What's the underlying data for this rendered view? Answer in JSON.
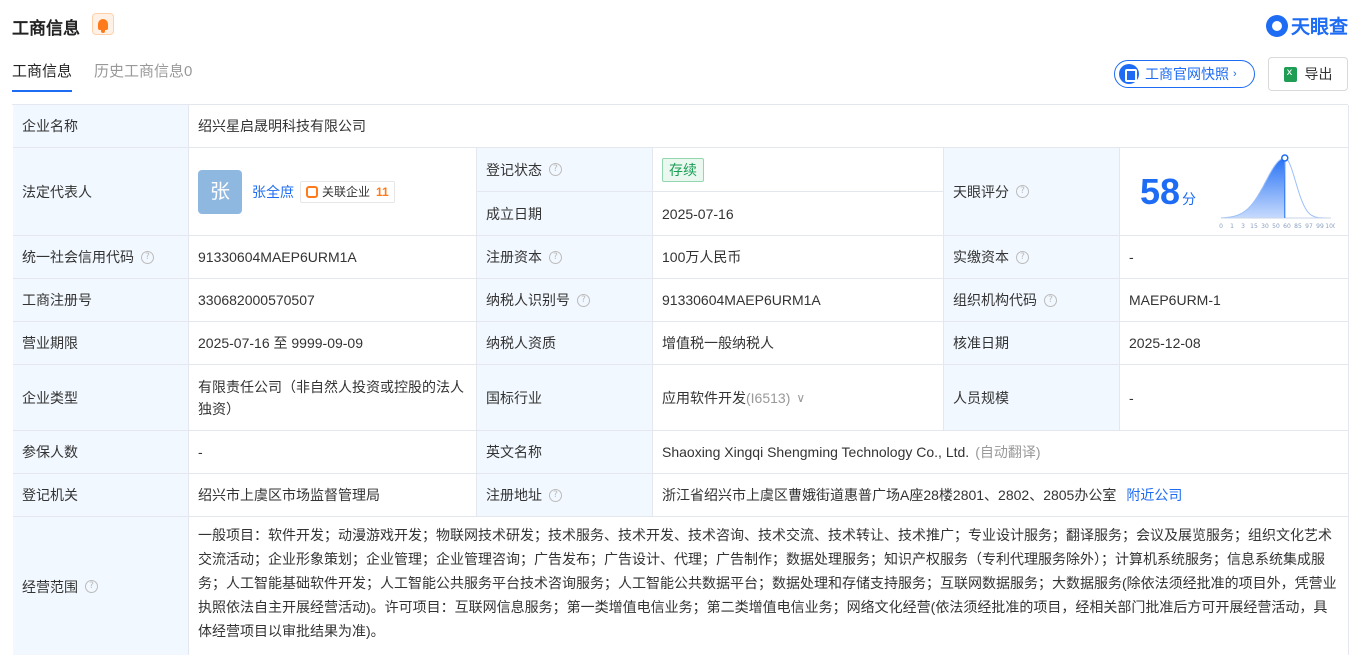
{
  "header": {
    "title": "工商信息",
    "logo_text": "天眼查"
  },
  "tabs": [
    {
      "label": "工商信息",
      "active": true
    },
    {
      "label": "历史工商信息0",
      "active": false
    }
  ],
  "actions": {
    "snapshot_label": "工商官网快照",
    "export_label": "导出"
  },
  "company": {
    "name_label": "企业名称",
    "name": "绍兴星启晟明科技有限公司",
    "legal_rep_label": "法定代表人",
    "legal_rep_avatar": "张",
    "legal_rep": "张全庶",
    "related_label": "关联企业",
    "related_count": "11",
    "status_label": "登记状态",
    "status": "存续",
    "founded_label": "成立日期",
    "founded": "2025-07-16",
    "score_label": "天眼评分",
    "score": "58",
    "score_unit": "分",
    "credit_code_label": "统一社会信用代码",
    "credit_code": "91330604MAEP6URM1A",
    "capital_label": "注册资本",
    "capital": "100万人民币",
    "paid_capital_label": "实缴资本",
    "paid_capital": "-",
    "reg_no_label": "工商注册号",
    "reg_no": "330682000570507",
    "taxpayer_id_label": "纳税人识别号",
    "taxpayer_id": "91330604MAEP6URM1A",
    "org_code_label": "组织机构代码",
    "org_code": "MAEP6URM-1",
    "term_label": "营业期限",
    "term": "2025-07-16 至 9999-09-09",
    "taxpayer_type_label": "纳税人资质",
    "taxpayer_type": "增值税一般纳税人",
    "approved_label": "核准日期",
    "approved": "2025-12-08",
    "type_label": "企业类型",
    "type": "有限责任公司（非自然人投资或控股的法人独资）",
    "industry_label": "国标行业",
    "industry": "应用软件开发",
    "industry_code": "(I6513)",
    "staff_label": "人员规模",
    "staff": "-",
    "insured_label": "参保人数",
    "insured": "-",
    "en_name_label": "英文名称",
    "en_name": "Shaoxing Xingqi Shengming Technology Co., Ltd.",
    "en_name_note": "(自动翻译)",
    "authority_label": "登记机关",
    "authority": "绍兴市上虞区市场监督管理局",
    "address_label": "注册地址",
    "address": "浙江省绍兴市上虞区曹娥街道惠普广场A座28楼2801、2802、2805办公室",
    "nearby_link": "附近公司",
    "scope_label": "经营范围",
    "scope": "一般项目：软件开发；动漫游戏开发；物联网技术研发；技术服务、技术开发、技术咨询、技术交流、技术转让、技术推广；专业设计服务；翻译服务；会议及展览服务；组织文化艺术交流活动；企业形象策划；企业管理；企业管理咨询；广告发布；广告设计、代理；广告制作；数据处理服务；知识产权服务（专利代理服务除外）；计算机系统服务；信息系统集成服务；人工智能基础软件开发；人工智能公共服务平台技术咨询服务；人工智能公共数据平台；数据处理和存储支持服务；互联网数据服务；大数据服务(除依法须经批准的项目外，凭营业执照依法自主开展经营活动)。许可项目：互联网信息服务；第一类增值电信业务；第二类增值电信业务；网络文化经营(依法须经批准的项目，经相关部门批准后方可开展经营活动，具体经营项目以审批结果为准)。"
  },
  "score_chart": {
    "type": "area",
    "x_ticks": [
      "0",
      "1",
      "3",
      "15",
      "30",
      "50",
      "60",
      "85",
      "97",
      "99",
      "100"
    ],
    "marker_value": 58,
    "colors": {
      "fill": "#1e6cf4",
      "line": "#9cc0fa"
    }
  }
}
